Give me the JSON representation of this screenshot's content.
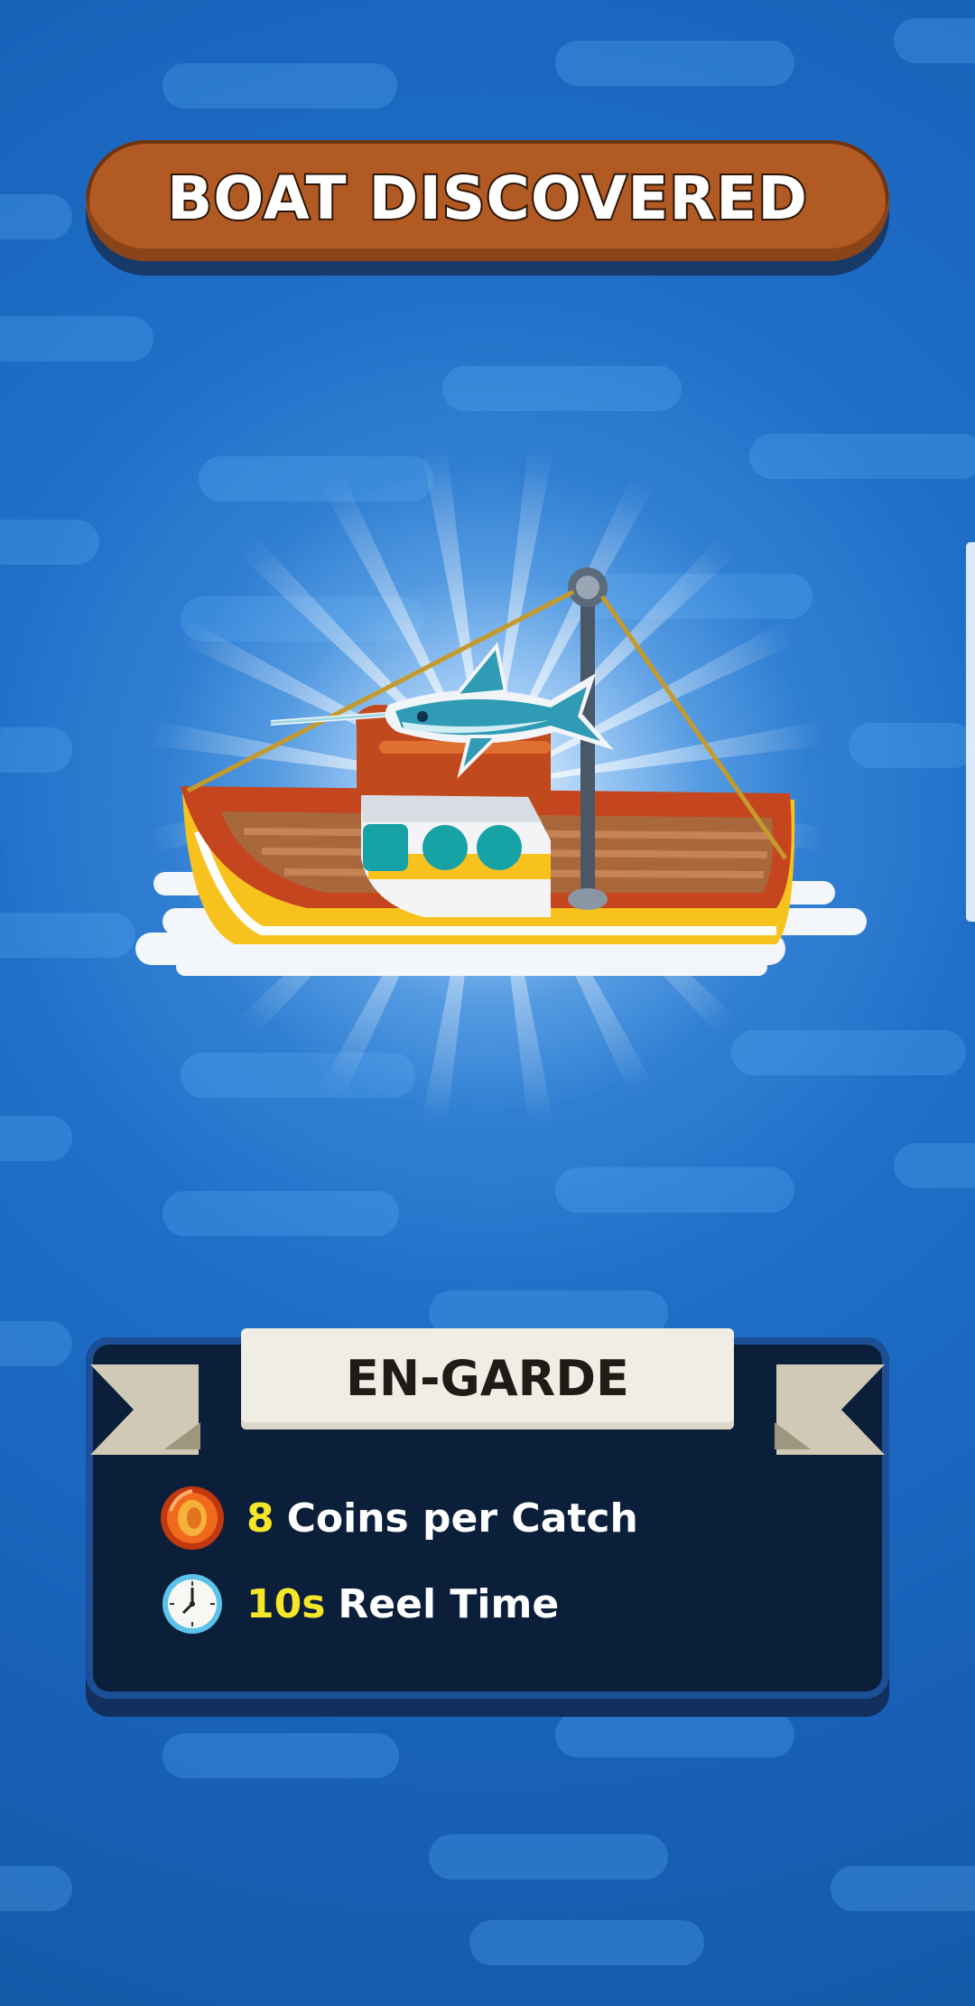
{
  "header": {
    "title": "BOAT DISCOVERED"
  },
  "boat": {
    "name": "EN-GARDE",
    "icon": "fishing-boat-with-swordfish"
  },
  "stats": [
    {
      "icon": "coin-icon",
      "value": "8",
      "label": "Coins per Catch"
    },
    {
      "icon": "clock-icon",
      "value": "10s",
      "label": "Reel Time"
    }
  ],
  "colors": {
    "background": "#1f6fc8",
    "title_plank": "#b15a23",
    "panel": "#0b1f3b",
    "ribbon": "#efede4",
    "stat_value": "#f5e62a",
    "stat_label": "#ffffff"
  }
}
